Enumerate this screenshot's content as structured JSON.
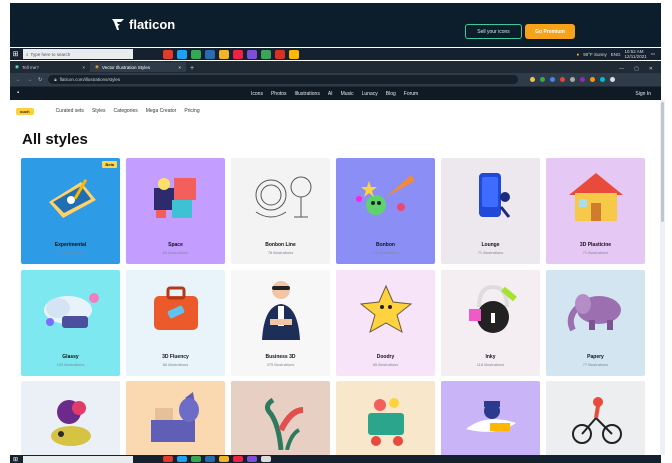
{
  "banner": {
    "logo_text": "flaticon",
    "sell_button": "Sell your icons",
    "premium_button": "Go Premium",
    "bg_color": "#0c1e2c",
    "accent": "#f6a21b"
  },
  "taskbar_top": {
    "search_placeholder": "Type here to search",
    "weather": "90°F Sunny",
    "language": "ENG",
    "time": "10:52 AM",
    "date": "12/11/2021"
  },
  "browser": {
    "tabs": [
      {
        "label": "Tell me?",
        "active": false
      },
      {
        "label": "Vector Illustration Styles",
        "active": true
      }
    ],
    "url": "flaticon.com/illustrations/styles"
  },
  "site_nav": {
    "links": [
      "Icons",
      "Photos",
      "Illustrations",
      "AI",
      "Music",
      "Lunacy",
      "Blog",
      "Forum"
    ],
    "signin": "Sign In"
  },
  "sub_nav": {
    "badge": "ouch",
    "links": [
      "Curated sets",
      "Styles",
      "Categories",
      "Mega Creator",
      "Pricing"
    ]
  },
  "page": {
    "title": "All styles"
  },
  "styles": [
    {
      "name": "Experimental",
      "count": "362 illustrations",
      "bg": "#2e9be6",
      "badge": "Beta",
      "icon": "blueprint-icon"
    },
    {
      "name": "Space",
      "count": "64 illustrations",
      "bg": "#c39dff",
      "badge": "",
      "icon": "puzzle-icon"
    },
    {
      "name": "Bonbon Line",
      "count": "78 illustrations",
      "bg": "#f3f3f3",
      "badge": "",
      "icon": "astronaut-line-icon"
    },
    {
      "name": "Bonbon",
      "count": "178 illustrations",
      "bg": "#8b8ff5",
      "badge": "",
      "icon": "party-icon"
    },
    {
      "name": "Lounge",
      "count": "71 illustrations",
      "bg": "#ece8ee",
      "badge": "",
      "icon": "phone-icon"
    },
    {
      "name": "3D Plasticine",
      "count": "71 illustrations",
      "bg": "#e5c8f4",
      "badge": "",
      "icon": "house-icon"
    },
    {
      "name": "Glassy",
      "count": "190 illustrations",
      "bg": "#7de8ef",
      "badge": "",
      "icon": "cloud-icon"
    },
    {
      "name": "3D Fluency",
      "count": "86 illustrations",
      "bg": "#e9f3fa",
      "badge": "",
      "icon": "suitcase-icon"
    },
    {
      "name": "Business 3D",
      "count": "375 illustrations",
      "bg": "#f7f7f7",
      "badge": "",
      "icon": "businessman-icon"
    },
    {
      "name": "Doodry",
      "count": "85 illustrations",
      "bg": "#f7e4f9",
      "badge": "",
      "icon": "star-icon"
    },
    {
      "name": "Inky",
      "count": "118 illustrations",
      "bg": "#f4eef3",
      "badge": "",
      "icon": "lock-icon"
    },
    {
      "name": "Papery",
      "count": "77 illustrations",
      "bg": "#d3e5f0",
      "badge": "",
      "icon": "elephant-icon"
    },
    {
      "name": "",
      "count": "",
      "bg": "#eaf0f5",
      "badge": "",
      "icon": "orchid-icon"
    },
    {
      "name": "",
      "count": "",
      "bg": "#fbd9b0",
      "badge": "",
      "icon": "cat-icon"
    },
    {
      "name": "",
      "count": "",
      "bg": "#e7cfc4",
      "badge": "",
      "icon": "plant-icon"
    },
    {
      "name": "",
      "count": "",
      "bg": "#f9e7cc",
      "badge": "",
      "icon": "cart-icon"
    },
    {
      "name": "",
      "count": "",
      "bg": "#c8b4f7",
      "badge": "",
      "icon": "bird-icon"
    },
    {
      "name": "",
      "count": "",
      "bg": "#eceef0",
      "badge": "",
      "icon": "cyclist-icon"
    }
  ]
}
